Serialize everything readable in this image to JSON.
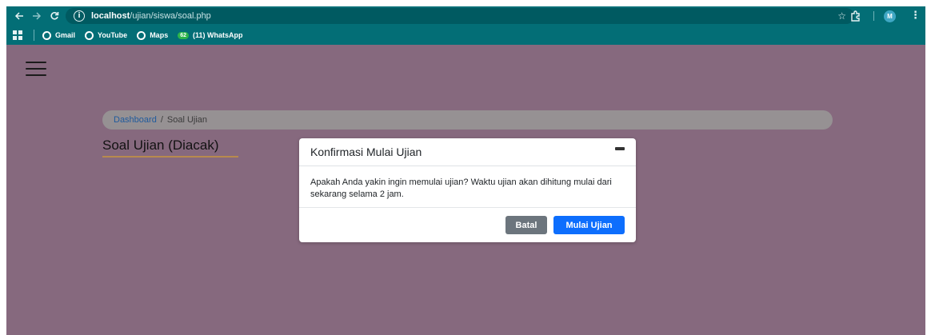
{
  "browser": {
    "url_host": "localhost",
    "url_path": "/ujian/siswa/soal.php",
    "avatar_letter": "M",
    "icons": [
      "back-icon",
      "forward-icon",
      "reload-icon",
      "info-icon",
      "star-icon",
      "extensions-icon",
      "menu-icon",
      "apps-icon"
    ],
    "bookmarks": [
      {
        "label": "Gmail",
        "icon": "globe-icon"
      },
      {
        "label": "YouTube",
        "icon": "globe-icon"
      },
      {
        "label": "Maps",
        "icon": "globe-icon"
      },
      {
        "label": "(11) WhatsApp",
        "badge": "62"
      }
    ]
  },
  "page": {
    "breadcrumb": {
      "link": "Dashboard",
      "separator": "/",
      "current": "Soal Ujian"
    },
    "title": "Soal Ujian (Diacak)"
  },
  "modal": {
    "title": "Konfirmasi Mulai Ujian",
    "body": "Apakah Anda yakin ingin memulai ujian? Waktu ujian akan dihitung mulai dari sekarang selama 2 jam.",
    "cancel_label": "Batal",
    "confirm_label": "Mulai Ujian"
  },
  "colors": {
    "browser_bar": "#036e76",
    "page_overlay": "#86697e",
    "primary_button": "#0d6efd",
    "secondary_button": "#6c757d",
    "title_underline": "#b88a4d"
  }
}
